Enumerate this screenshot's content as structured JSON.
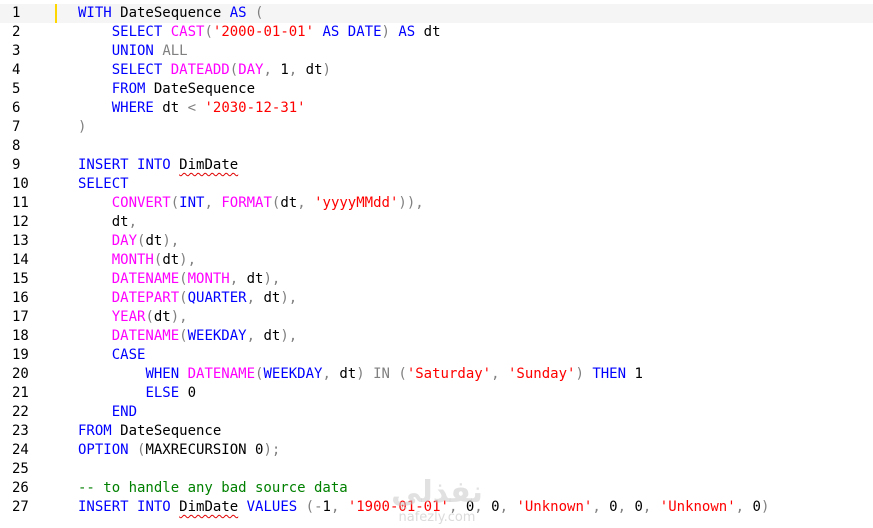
{
  "editor": {
    "lines": [
      {
        "num": "1",
        "tokens": [
          {
            "t": "WITH",
            "c": "kw"
          },
          {
            "t": " DateSequence ",
            "c": "plain"
          },
          {
            "t": "AS",
            "c": "kw"
          },
          {
            "t": " (",
            "c": "gray"
          }
        ]
      },
      {
        "num": "2",
        "tokens": [
          {
            "t": "    ",
            "c": "plain"
          },
          {
            "t": "SELECT",
            "c": "kw"
          },
          {
            "t": " ",
            "c": "plain"
          },
          {
            "t": "CAST",
            "c": "fn"
          },
          {
            "t": "(",
            "c": "gray"
          },
          {
            "t": "'2000-01-01'",
            "c": "str"
          },
          {
            "t": " ",
            "c": "plain"
          },
          {
            "t": "AS",
            "c": "kw"
          },
          {
            "t": " ",
            "c": "plain"
          },
          {
            "t": "DATE",
            "c": "kw"
          },
          {
            "t": ")",
            "c": "gray"
          },
          {
            "t": " ",
            "c": "plain"
          },
          {
            "t": "AS",
            "c": "kw"
          },
          {
            "t": " dt",
            "c": "plain"
          }
        ]
      },
      {
        "num": "3",
        "tokens": [
          {
            "t": "    ",
            "c": "plain"
          },
          {
            "t": "UNION",
            "c": "kw"
          },
          {
            "t": " ",
            "c": "plain"
          },
          {
            "t": "ALL",
            "c": "gray"
          }
        ]
      },
      {
        "num": "4",
        "tokens": [
          {
            "t": "    ",
            "c": "plain"
          },
          {
            "t": "SELECT",
            "c": "kw"
          },
          {
            "t": " ",
            "c": "plain"
          },
          {
            "t": "DATEADD",
            "c": "fn"
          },
          {
            "t": "(",
            "c": "gray"
          },
          {
            "t": "DAY",
            "c": "fn"
          },
          {
            "t": ",",
            "c": "gray"
          },
          {
            "t": " 1",
            "c": "plain"
          },
          {
            "t": ",",
            "c": "gray"
          },
          {
            "t": " dt",
            "c": "plain"
          },
          {
            "t": ")",
            "c": "gray"
          }
        ]
      },
      {
        "num": "5",
        "tokens": [
          {
            "t": "    ",
            "c": "plain"
          },
          {
            "t": "FROM",
            "c": "kw"
          },
          {
            "t": " DateSequence",
            "c": "plain"
          }
        ]
      },
      {
        "num": "6",
        "tokens": [
          {
            "t": "    ",
            "c": "plain"
          },
          {
            "t": "WHERE",
            "c": "kw"
          },
          {
            "t": " dt ",
            "c": "plain"
          },
          {
            "t": "<",
            "c": "gray"
          },
          {
            "t": " ",
            "c": "plain"
          },
          {
            "t": "'2030-12-31'",
            "c": "str"
          }
        ]
      },
      {
        "num": "7",
        "tokens": [
          {
            "t": ")",
            "c": "gray"
          }
        ]
      },
      {
        "num": "8",
        "tokens": []
      },
      {
        "num": "9",
        "tokens": [
          {
            "t": "INSERT",
            "c": "kw"
          },
          {
            "t": " ",
            "c": "plain"
          },
          {
            "t": "INTO",
            "c": "kw"
          },
          {
            "t": " ",
            "c": "plain"
          },
          {
            "t": "DimDate",
            "c": "plain",
            "sq": true
          }
        ]
      },
      {
        "num": "10",
        "tokens": [
          {
            "t": "SELECT",
            "c": "kw"
          }
        ]
      },
      {
        "num": "11",
        "tokens": [
          {
            "t": "    ",
            "c": "plain"
          },
          {
            "t": "CONVERT",
            "c": "fn"
          },
          {
            "t": "(",
            "c": "gray"
          },
          {
            "t": "INT",
            "c": "kw"
          },
          {
            "t": ",",
            "c": "gray"
          },
          {
            "t": " ",
            "c": "plain"
          },
          {
            "t": "FORMAT",
            "c": "fn"
          },
          {
            "t": "(",
            "c": "gray"
          },
          {
            "t": "dt",
            "c": "plain"
          },
          {
            "t": ",",
            "c": "gray"
          },
          {
            "t": " ",
            "c": "plain"
          },
          {
            "t": "'yyyyMMdd'",
            "c": "str"
          },
          {
            "t": "))",
            "c": "gray"
          },
          {
            "t": ",",
            "c": "gray"
          }
        ]
      },
      {
        "num": "12",
        "tokens": [
          {
            "t": "    dt",
            "c": "plain"
          },
          {
            "t": ",",
            "c": "gray"
          }
        ]
      },
      {
        "num": "13",
        "tokens": [
          {
            "t": "    ",
            "c": "plain"
          },
          {
            "t": "DAY",
            "c": "fn"
          },
          {
            "t": "(",
            "c": "gray"
          },
          {
            "t": "dt",
            "c": "plain"
          },
          {
            "t": ")",
            "c": "gray"
          },
          {
            "t": ",",
            "c": "gray"
          }
        ]
      },
      {
        "num": "14",
        "tokens": [
          {
            "t": "    ",
            "c": "plain"
          },
          {
            "t": "MONTH",
            "c": "fn"
          },
          {
            "t": "(",
            "c": "gray"
          },
          {
            "t": "dt",
            "c": "plain"
          },
          {
            "t": ")",
            "c": "gray"
          },
          {
            "t": ",",
            "c": "gray"
          }
        ]
      },
      {
        "num": "15",
        "tokens": [
          {
            "t": "    ",
            "c": "plain"
          },
          {
            "t": "DATENAME",
            "c": "fn"
          },
          {
            "t": "(",
            "c": "gray"
          },
          {
            "t": "MONTH",
            "c": "fn"
          },
          {
            "t": ",",
            "c": "gray"
          },
          {
            "t": " dt",
            "c": "plain"
          },
          {
            "t": ")",
            "c": "gray"
          },
          {
            "t": ",",
            "c": "gray"
          }
        ]
      },
      {
        "num": "16",
        "tokens": [
          {
            "t": "    ",
            "c": "plain"
          },
          {
            "t": "DATEPART",
            "c": "fn"
          },
          {
            "t": "(",
            "c": "gray"
          },
          {
            "t": "QUARTER",
            "c": "kw"
          },
          {
            "t": ",",
            "c": "gray"
          },
          {
            "t": " dt",
            "c": "plain"
          },
          {
            "t": ")",
            "c": "gray"
          },
          {
            "t": ",",
            "c": "gray"
          }
        ]
      },
      {
        "num": "17",
        "tokens": [
          {
            "t": "    ",
            "c": "plain"
          },
          {
            "t": "YEAR",
            "c": "fn"
          },
          {
            "t": "(",
            "c": "gray"
          },
          {
            "t": "dt",
            "c": "plain"
          },
          {
            "t": ")",
            "c": "gray"
          },
          {
            "t": ",",
            "c": "gray"
          }
        ]
      },
      {
        "num": "18",
        "tokens": [
          {
            "t": "    ",
            "c": "plain"
          },
          {
            "t": "DATENAME",
            "c": "fn"
          },
          {
            "t": "(",
            "c": "gray"
          },
          {
            "t": "WEEKDAY",
            "c": "kw"
          },
          {
            "t": ",",
            "c": "gray"
          },
          {
            "t": " dt",
            "c": "plain"
          },
          {
            "t": ")",
            "c": "gray"
          },
          {
            "t": ",",
            "c": "gray"
          }
        ]
      },
      {
        "num": "19",
        "tokens": [
          {
            "t": "    ",
            "c": "plain"
          },
          {
            "t": "CASE",
            "c": "kw"
          }
        ]
      },
      {
        "num": "20",
        "tokens": [
          {
            "t": "        ",
            "c": "plain"
          },
          {
            "t": "WHEN",
            "c": "kw"
          },
          {
            "t": " ",
            "c": "plain"
          },
          {
            "t": "DATENAME",
            "c": "fn"
          },
          {
            "t": "(",
            "c": "gray"
          },
          {
            "t": "WEEKDAY",
            "c": "kw"
          },
          {
            "t": ",",
            "c": "gray"
          },
          {
            "t": " dt",
            "c": "plain"
          },
          {
            "t": ")",
            "c": "gray"
          },
          {
            "t": " ",
            "c": "plain"
          },
          {
            "t": "IN",
            "c": "gray"
          },
          {
            "t": " ",
            "c": "plain"
          },
          {
            "t": "(",
            "c": "gray"
          },
          {
            "t": "'Saturday'",
            "c": "str"
          },
          {
            "t": ",",
            "c": "gray"
          },
          {
            "t": " ",
            "c": "plain"
          },
          {
            "t": "'Sunday'",
            "c": "str"
          },
          {
            "t": ")",
            "c": "gray"
          },
          {
            "t": " ",
            "c": "plain"
          },
          {
            "t": "THEN",
            "c": "kw"
          },
          {
            "t": " 1",
            "c": "plain"
          }
        ]
      },
      {
        "num": "21",
        "tokens": [
          {
            "t": "        ",
            "c": "plain"
          },
          {
            "t": "ELSE",
            "c": "kw"
          },
          {
            "t": " 0",
            "c": "plain"
          }
        ]
      },
      {
        "num": "22",
        "tokens": [
          {
            "t": "    ",
            "c": "plain"
          },
          {
            "t": "END",
            "c": "kw"
          }
        ]
      },
      {
        "num": "23",
        "tokens": [
          {
            "t": "FROM",
            "c": "kw"
          },
          {
            "t": " DateSequence",
            "c": "plain"
          }
        ]
      },
      {
        "num": "24",
        "tokens": [
          {
            "t": "OPTION",
            "c": "kw"
          },
          {
            "t": " ",
            "c": "plain"
          },
          {
            "t": "(",
            "c": "gray"
          },
          {
            "t": "MAXRECURSION 0",
            "c": "plain"
          },
          {
            "t": ");",
            "c": "gray"
          }
        ]
      },
      {
        "num": "25",
        "tokens": []
      },
      {
        "num": "26",
        "tokens": [
          {
            "t": "-- to handle any bad source data",
            "c": "cm"
          }
        ]
      },
      {
        "num": "27",
        "tokens": [
          {
            "t": "INSERT",
            "c": "kw"
          },
          {
            "t": " ",
            "c": "plain"
          },
          {
            "t": "INTO",
            "c": "kw"
          },
          {
            "t": " ",
            "c": "plain"
          },
          {
            "t": "DimDate",
            "c": "plain",
            "sq": true
          },
          {
            "t": " ",
            "c": "plain"
          },
          {
            "t": "VALUES",
            "c": "kw"
          },
          {
            "t": " ",
            "c": "plain"
          },
          {
            "t": "(",
            "c": "gray"
          },
          {
            "t": "-",
            "c": "gray"
          },
          {
            "t": "1",
            "c": "plain"
          },
          {
            "t": ",",
            "c": "gray"
          },
          {
            "t": " ",
            "c": "plain"
          },
          {
            "t": "'1900-01-01'",
            "c": "str"
          },
          {
            "t": ",",
            "c": "gray"
          },
          {
            "t": " 0",
            "c": "plain"
          },
          {
            "t": ",",
            "c": "gray"
          },
          {
            "t": " 0",
            "c": "plain"
          },
          {
            "t": ",",
            "c": "gray"
          },
          {
            "t": " ",
            "c": "plain"
          },
          {
            "t": "'Unknown'",
            "c": "str"
          },
          {
            "t": ",",
            "c": "gray"
          },
          {
            "t": " 0",
            "c": "plain"
          },
          {
            "t": ",",
            "c": "gray"
          },
          {
            "t": " 0",
            "c": "plain"
          },
          {
            "t": ",",
            "c": "gray"
          },
          {
            "t": " ",
            "c": "plain"
          },
          {
            "t": "'Unknown'",
            "c": "str"
          },
          {
            "t": ",",
            "c": "gray"
          },
          {
            "t": " 0",
            "c": "plain"
          },
          {
            "t": ")",
            "c": "gray"
          }
        ]
      }
    ]
  },
  "watermark": {
    "arabic": "نفذلي",
    "latin": "nafezly.com"
  },
  "colors": {
    "keyword": "#0000ff",
    "function": "#ff00ff",
    "string": "#ff0000",
    "operator": "#808080",
    "comment": "#008000",
    "caret": "#ffd700",
    "current_line": "#f5f5f5"
  }
}
